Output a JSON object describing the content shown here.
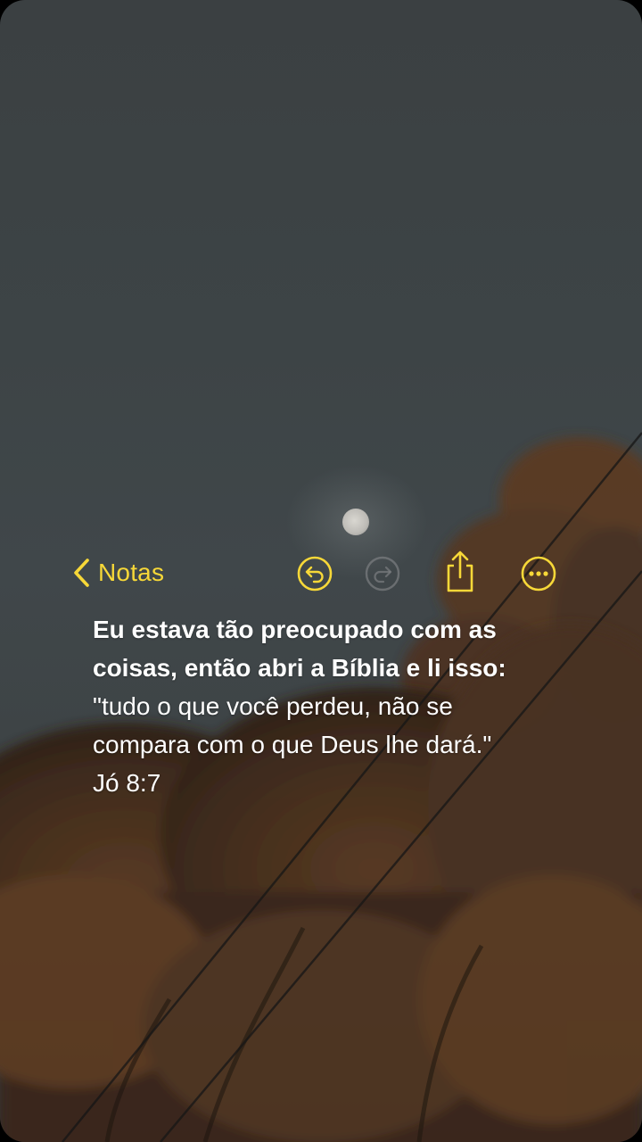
{
  "nav": {
    "back_label": "Notas",
    "icons": {
      "back": "chevron-left-icon",
      "undo": "undo-icon",
      "redo": "redo-icon",
      "share": "share-icon",
      "more": "more-icon"
    },
    "accent_color": "#f7d838"
  },
  "note": {
    "bold_lines": [
      "Eu estava tão preocupado com as",
      "coisas, então abri a Bíblia e li isso:"
    ],
    "quote_lines": [
      "\"tudo o que você perdeu, não se",
      "compara com o que Deus lhe dará.\""
    ],
    "reference": "Jó 8:7"
  }
}
